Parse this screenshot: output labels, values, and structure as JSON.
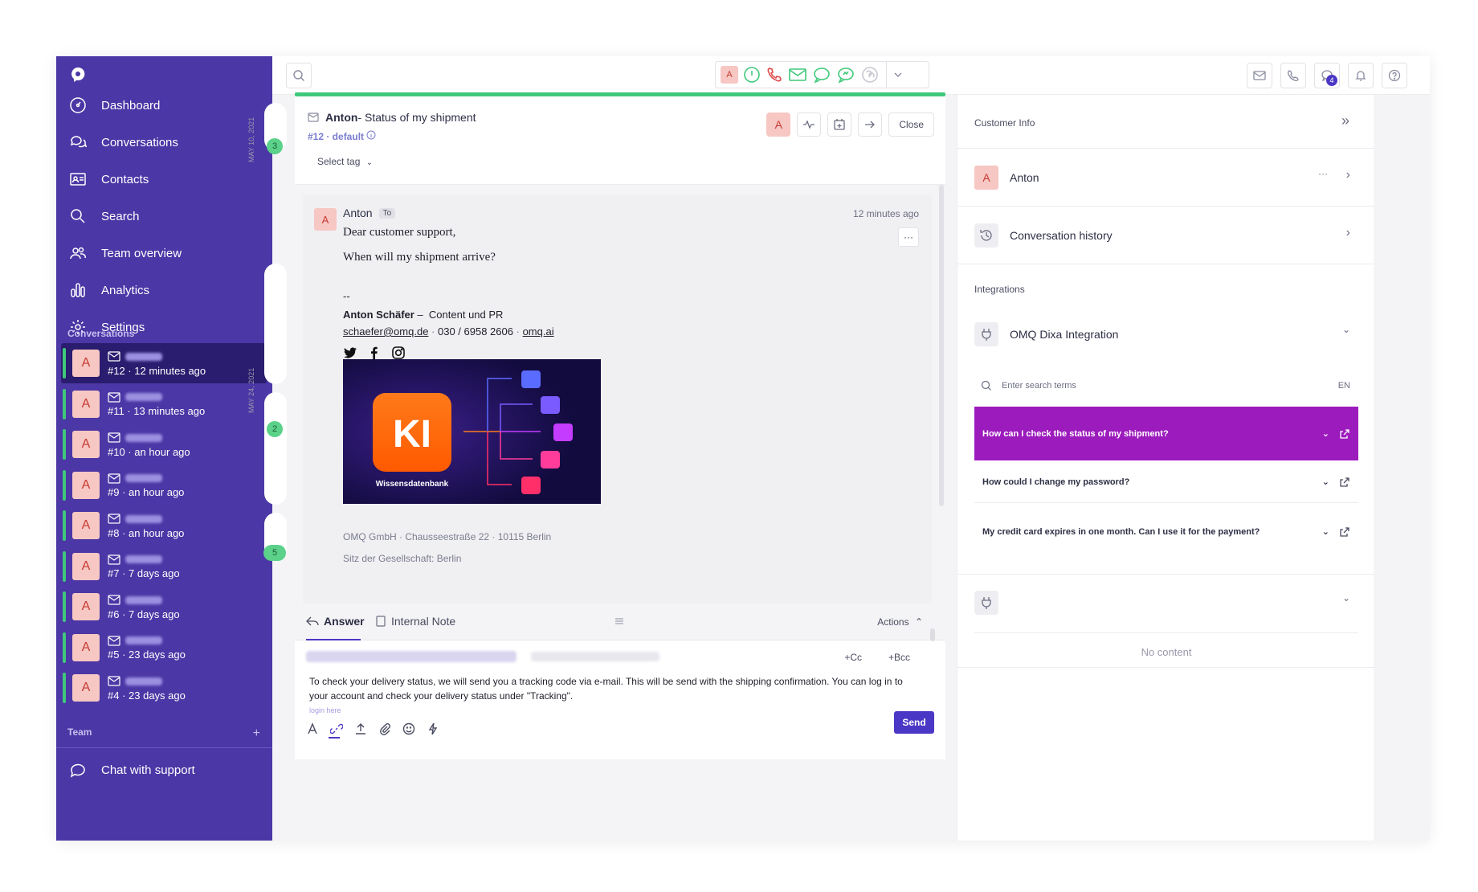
{
  "sidebar": {
    "nav": [
      {
        "label": "Dashboard",
        "icon": "dashboard-icon"
      },
      {
        "label": "Conversations",
        "icon": "conversations-icon"
      },
      {
        "label": "Contacts",
        "icon": "contacts-icon"
      },
      {
        "label": "Search",
        "icon": "search-icon"
      },
      {
        "label": "Team overview",
        "icon": "team-icon"
      },
      {
        "label": "Analytics",
        "icon": "analytics-icon"
      },
      {
        "label": "Settings",
        "icon": "settings-icon"
      }
    ],
    "conversations_label": "Conversations",
    "conversations": [
      {
        "avatar": "A",
        "meta": "#12 · 12 minutes ago",
        "active": true
      },
      {
        "avatar": "A",
        "meta": "#11 · 13 minutes ago"
      },
      {
        "avatar": "A",
        "meta": "#10 · an hour ago"
      },
      {
        "avatar": "A",
        "meta": "#9 · an hour ago"
      },
      {
        "avatar": "A",
        "meta": "#8 · an hour ago"
      },
      {
        "avatar": "A",
        "meta": "#7 · 7 days ago"
      },
      {
        "avatar": "A",
        "meta": "#6 · 7 days ago"
      },
      {
        "avatar": "A",
        "meta": "#5 · 23 days ago"
      },
      {
        "avatar": "A",
        "meta": "#4 · 23 days ago"
      }
    ],
    "team_label": "Team",
    "team_add": "+",
    "chat_support": "Chat with support"
  },
  "topbar": {
    "channel_avatar": "A",
    "notification_count": "4"
  },
  "timeline": {
    "date1": "MAY 10, 2021",
    "date2": "MAY 24, 2021",
    "count1": "3",
    "count2": "2",
    "count3": "5"
  },
  "conversation": {
    "contact": "Anton",
    "subject": " - Status of my shipment",
    "ticket": "#12 · default",
    "select_tag": "Select tag",
    "header_avatar": "A",
    "close_label": "Close"
  },
  "message": {
    "from": "Anton",
    "to_tag": "To",
    "avatar": "A",
    "time": "12 minutes ago",
    "more": "···",
    "greeting": "Dear customer support,",
    "body": "When will my shipment arrive?",
    "sig_dash": "--",
    "sig_name": "Anton Schäfer",
    "sig_sep": " –  ",
    "sig_role": "Content und PR",
    "sig_email": "schaefer@omq.de",
    "sig_phone": "030 / 6958 2606",
    "sig_web": "omq.ai",
    "banner_title": "KI",
    "banner_caption": "Wissensdatenbank",
    "footer1": "OMQ GmbH · Chausseestraße 22 · 10115 Berlin",
    "footer2": "Sitz der Gesellschaft: Berlin"
  },
  "reply": {
    "tab_answer": "Answer",
    "tab_note": "Internal Note",
    "actions": "Actions",
    "cc": "+Cc",
    "bcc": "+Bcc",
    "text": "To check your delivery status, we will send you a tracking code via e-mail. This will be send with the shipping confirmation. You can log in to your account and check your delivery status under \"Tracking\".",
    "cut_text": "login here",
    "send": "Send"
  },
  "right_panel": {
    "title": "Customer Info",
    "customer_avatar": "A",
    "customer_name": "Anton",
    "customer_more": "···",
    "history": "Conversation history",
    "integrations_label": "Integrations",
    "integration_name": "OMQ Dixa Integration",
    "search_placeholder": "Enter search terms",
    "lang": "EN",
    "faqs": [
      "How can I check the status of my shipment?",
      "How could I change my password?",
      "My credit card expires in one month. Can I use it for the payment?"
    ],
    "no_content": "No content"
  },
  "colors": {
    "sidebar": "#4b37a5",
    "accent": "#4b37c6",
    "success": "#3fc97a",
    "faq_active": "#9c1bbd"
  }
}
